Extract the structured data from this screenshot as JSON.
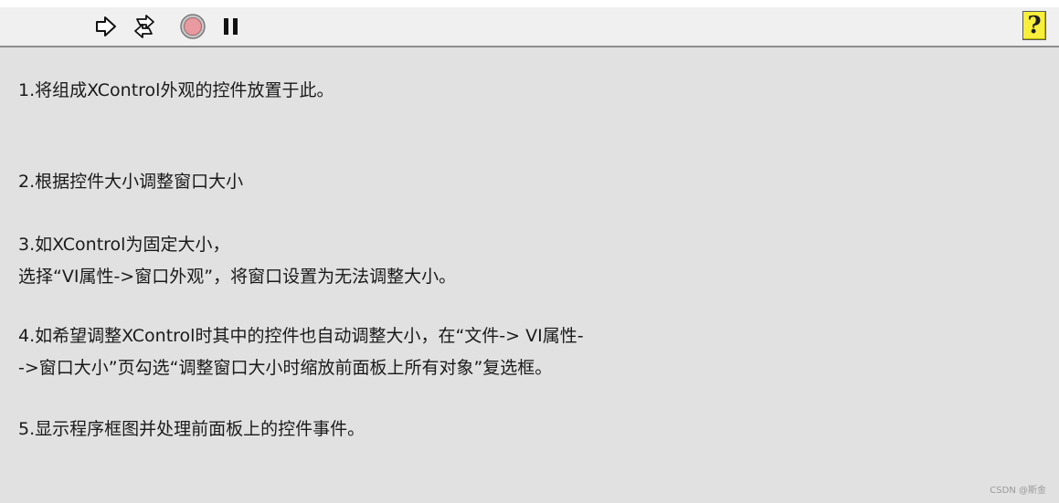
{
  "toolbar": {
    "run_icon": "run-arrow-icon",
    "run_continuously_icon": "run-continuously-icon",
    "abort_icon": "abort-execution-icon",
    "pause_icon": "pause-icon",
    "help_icon": "context-help-icon",
    "help_glyph": "?"
  },
  "panel": {
    "notes": [
      {
        "lines": [
          "1.将组成XControl外观的控件放置于此。"
        ]
      },
      {
        "lines": [
          "2.根据控件大小调整窗口大小"
        ]
      },
      {
        "lines": [
          "3.如XControl为固定大小，",
          "选择“VI属性->窗口外观”，将窗口设置为无法调整大小。"
        ]
      },
      {
        "lines": [
          "4.如希望调整XControl时其中的控件也自动调整大小，在“文件-> VI属性-",
          "->窗口大小”页勾选“调整窗口大小时缩放前面板上所有对象”复选框。"
        ]
      },
      {
        "lines": [
          "5.显示程序框图并处理前面板上的控件事件。"
        ]
      }
    ]
  },
  "watermark": "CSDN @斯金",
  "colors": {
    "panel_bg": "#e1e1e1",
    "toolbar_bg": "#f0f0f0",
    "help_bg": "#f7ef3b",
    "abort_fill": "#e89aa0"
  }
}
